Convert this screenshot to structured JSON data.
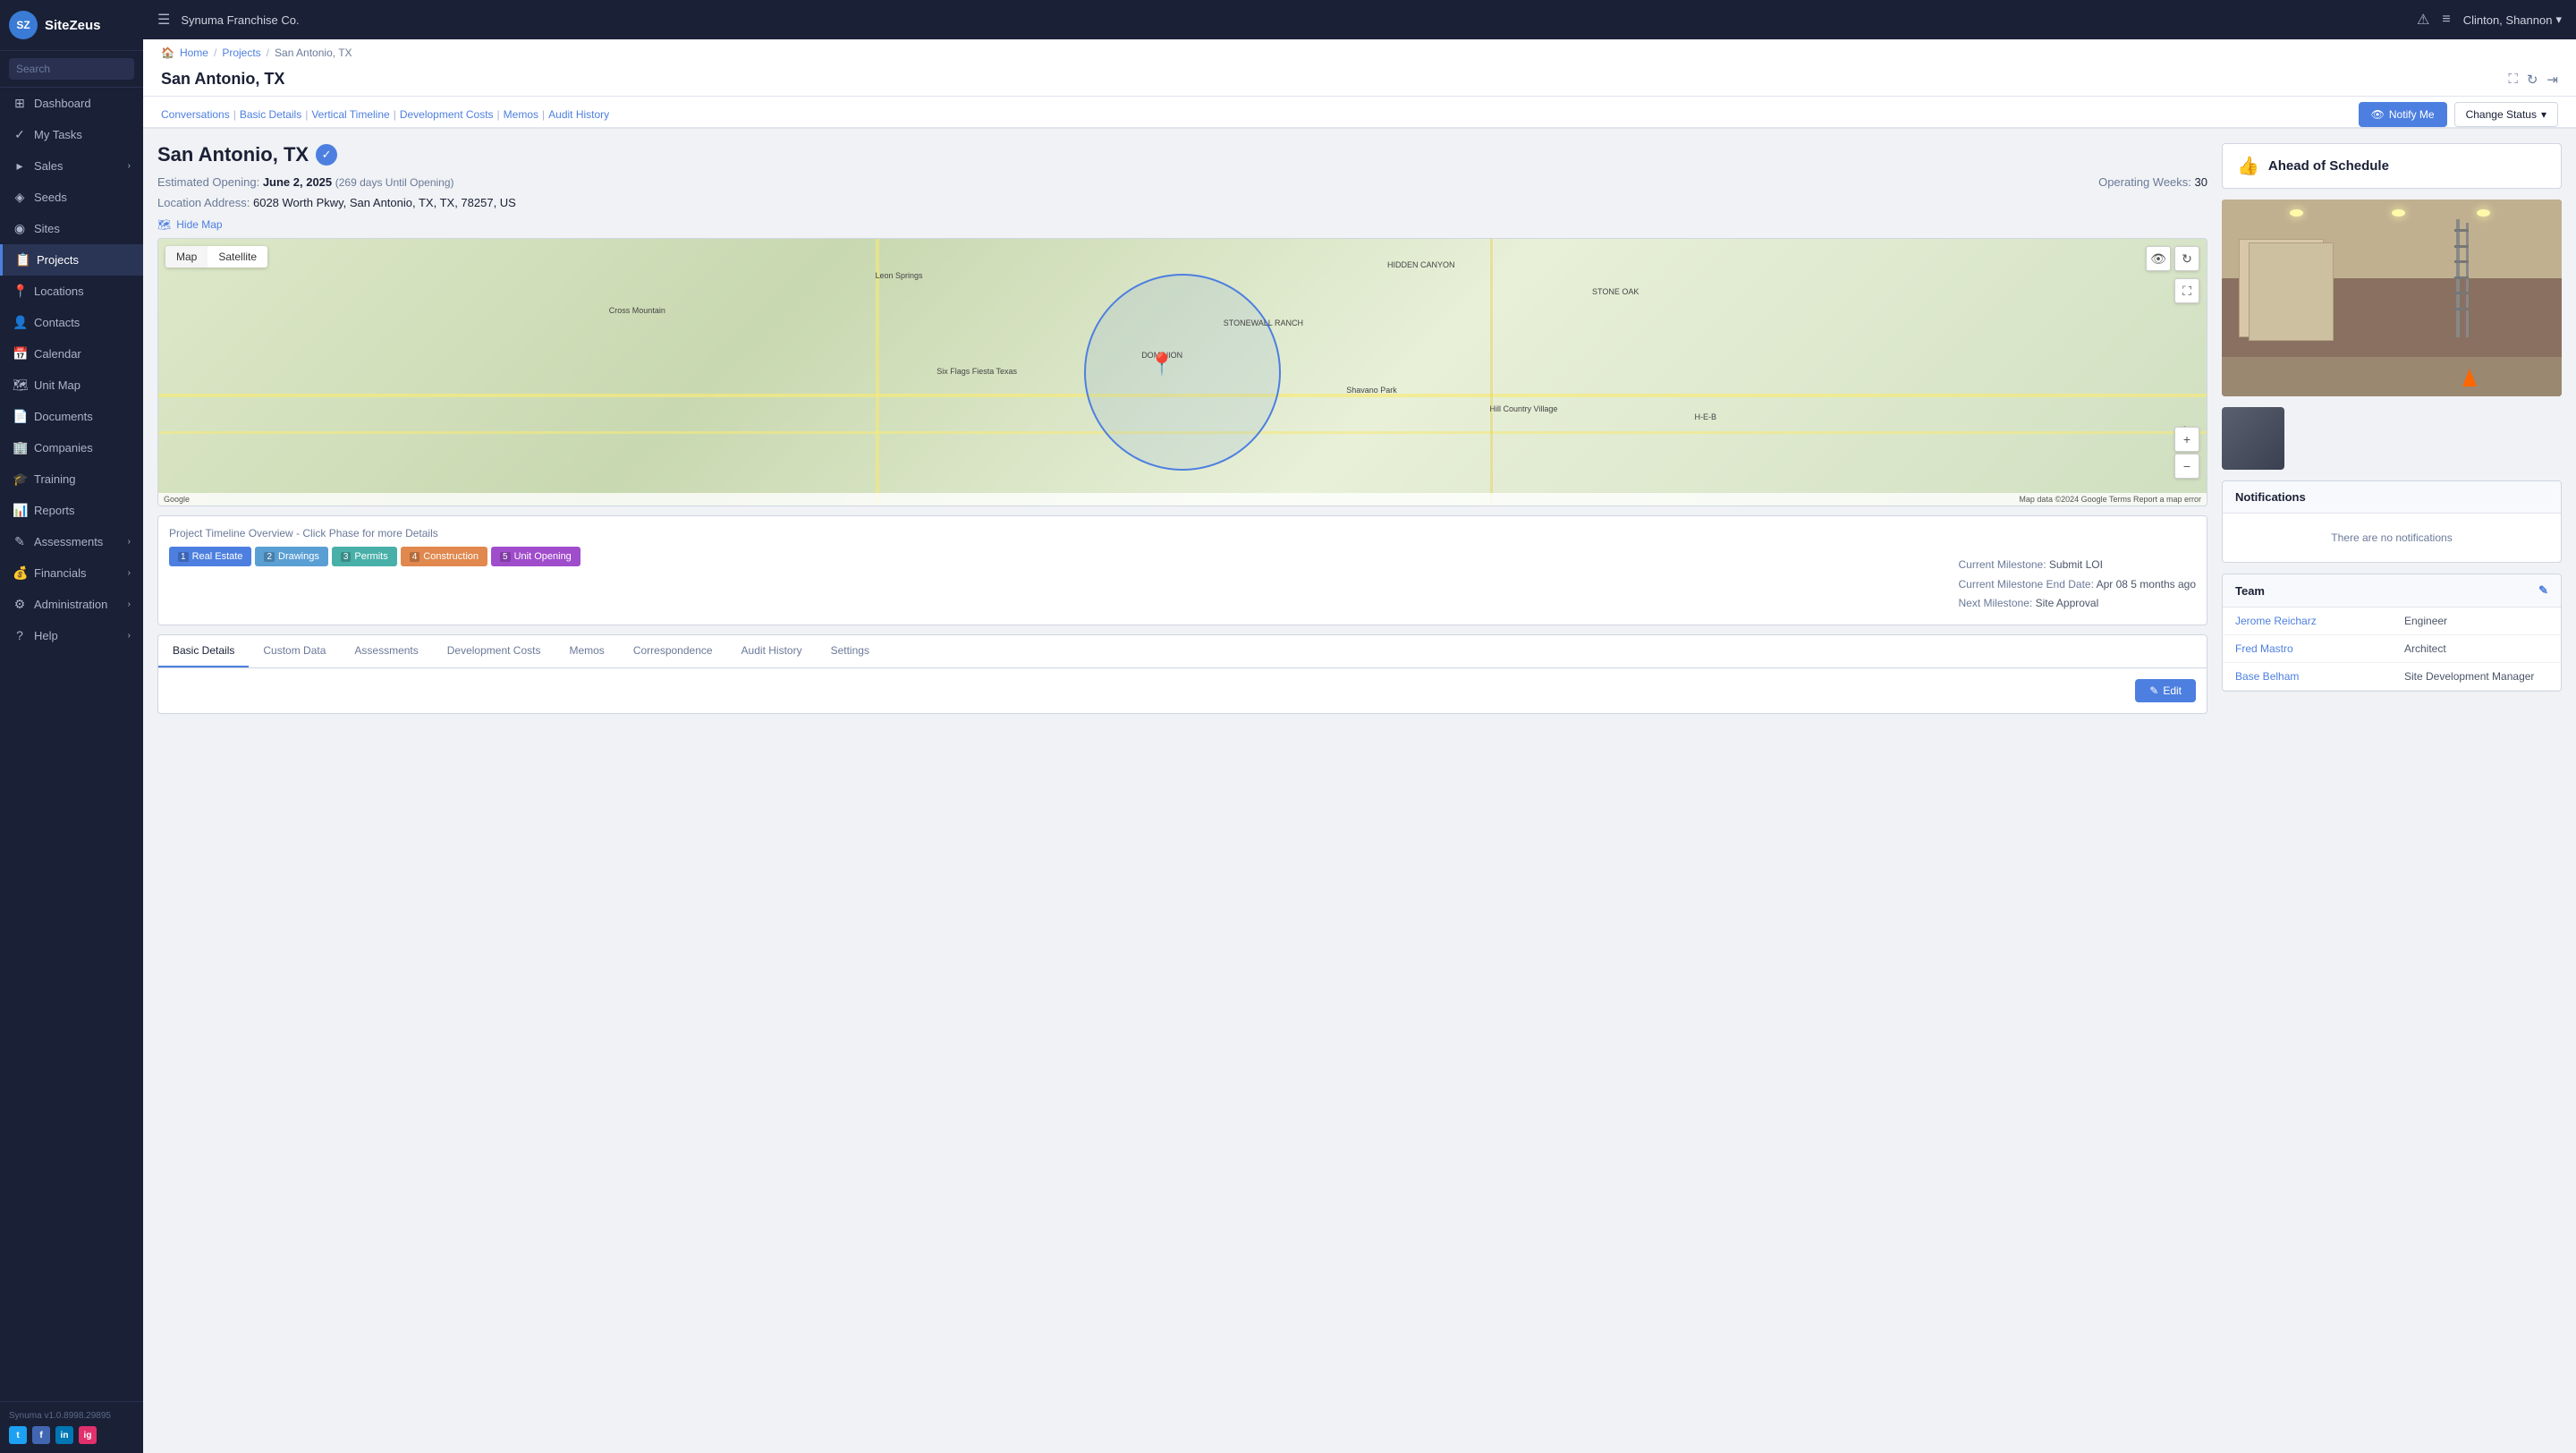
{
  "app": {
    "logo_initials": "SZ",
    "logo_name": "SiteZeus",
    "company": "Synuma Franchise Co.",
    "version": "Synuma v1.0.8998.29895"
  },
  "topbar": {
    "alert_icon": "⚠",
    "messages_icon": "≡",
    "user": "Clinton, Shannon",
    "chevron": "▾"
  },
  "sidebar": {
    "search_placeholder": "Search",
    "items": [
      {
        "id": "dashboard",
        "label": "Dashboard",
        "icon": "⊞",
        "active": false
      },
      {
        "id": "my-tasks",
        "label": "My Tasks",
        "icon": "✓",
        "active": false
      },
      {
        "id": "sales",
        "label": "Sales",
        "icon": "▸",
        "active": false,
        "has_arrow": true
      },
      {
        "id": "seeds",
        "label": "Seeds",
        "icon": "◈",
        "active": false
      },
      {
        "id": "sites",
        "label": "Sites",
        "icon": "◉",
        "active": false
      },
      {
        "id": "projects",
        "label": "Projects",
        "icon": "📋",
        "active": true
      },
      {
        "id": "locations",
        "label": "Locations",
        "icon": "📍",
        "active": false
      },
      {
        "id": "contacts",
        "label": "Contacts",
        "icon": "👤",
        "active": false
      },
      {
        "id": "calendar",
        "label": "Calendar",
        "icon": "📅",
        "active": false
      },
      {
        "id": "unit-map",
        "label": "Unit Map",
        "icon": "🗺",
        "active": false
      },
      {
        "id": "documents",
        "label": "Documents",
        "icon": "📄",
        "active": false
      },
      {
        "id": "companies",
        "label": "Companies",
        "icon": "🏢",
        "active": false
      },
      {
        "id": "training",
        "label": "Training",
        "icon": "🎓",
        "active": false
      },
      {
        "id": "reports",
        "label": "Reports",
        "icon": "📊",
        "active": false
      },
      {
        "id": "assessments",
        "label": "Assessments",
        "icon": "✎",
        "active": false,
        "has_arrow": true
      },
      {
        "id": "financials",
        "label": "Financials",
        "icon": "💰",
        "active": false,
        "has_arrow": true
      },
      {
        "id": "administration",
        "label": "Administration",
        "icon": "⚙",
        "active": false,
        "has_arrow": true
      },
      {
        "id": "help",
        "label": "Help",
        "icon": "?",
        "active": false,
        "has_arrow": true
      }
    ],
    "social": [
      {
        "id": "twitter",
        "label": "t",
        "color": "#1da1f2"
      },
      {
        "id": "facebook",
        "label": "f",
        "color": "#4267b2"
      },
      {
        "id": "linkedin",
        "label": "in",
        "color": "#0077b5"
      },
      {
        "id": "instagram",
        "label": "ig",
        "color": "#e1306c"
      }
    ]
  },
  "breadcrumb": {
    "home": "Home",
    "projects": "Projects",
    "current": "San Antonio, TX"
  },
  "page": {
    "title": "San Antonio, TX",
    "project_name": "San Antonio, TX",
    "verified": true,
    "schedule_status": "Ahead of Schedule",
    "estimated_opening_label": "Estimated Opening:",
    "estimated_opening_date": "June 2, 2025",
    "estimated_opening_days": "(269 days Until Opening)",
    "operating_weeks_label": "Operating Weeks:",
    "operating_weeks": "30",
    "location_address_label": "Location Address:",
    "location_address": "6028 Worth Pkwy, San Antonio, TX, TX, 78257, US",
    "hide_map_label": "Hide Map",
    "map_tab_map": "Map",
    "map_tab_satellite": "Satellite"
  },
  "sub_nav": {
    "links": [
      {
        "id": "conversations",
        "label": "Conversations"
      },
      {
        "id": "basic-details",
        "label": "Basic Details"
      },
      {
        "id": "vertical-timeline",
        "label": "Vertical Timeline"
      },
      {
        "id": "development-costs",
        "label": "Development Costs"
      },
      {
        "id": "memos",
        "label": "Memos"
      },
      {
        "id": "audit-history",
        "label": "Audit History"
      }
    ],
    "notify_label": "Notify Me",
    "change_status_label": "Change Status"
  },
  "timeline": {
    "title": "Project Timeline Overview - Click Phase for more Details",
    "phases": [
      {
        "id": 1,
        "label": "Real Estate",
        "color": "#4d7fe0"
      },
      {
        "id": 2,
        "label": "Drawings",
        "color": "#5a9fd4"
      },
      {
        "id": 3,
        "label": "Permits",
        "color": "#48b0a8"
      },
      {
        "id": 4,
        "label": "Construction",
        "color": "#e0884d"
      },
      {
        "id": 5,
        "label": "Unit Opening",
        "color": "#a04dcc"
      }
    ],
    "current_milestone_label": "Current Milestone:",
    "current_milestone": "Submit LOI",
    "current_milestone_end_label": "Current Milestone End Date:",
    "current_milestone_end": "Apr 08 5 months ago",
    "next_milestone_label": "Next Milestone:",
    "next_milestone": "Site Approval"
  },
  "bottom_tabs": {
    "tabs": [
      {
        "id": "basic-details",
        "label": "Basic Details",
        "active": true
      },
      {
        "id": "custom-data",
        "label": "Custom Data",
        "active": false
      },
      {
        "id": "assessments",
        "label": "Assessments",
        "active": false
      },
      {
        "id": "development-costs",
        "label": "Development Costs",
        "active": false
      },
      {
        "id": "memos",
        "label": "Memos",
        "active": false
      },
      {
        "id": "correspondence",
        "label": "Correspondence",
        "active": false
      },
      {
        "id": "audit-history",
        "label": "Audit History",
        "active": false
      },
      {
        "id": "settings",
        "label": "Settings",
        "active": false
      }
    ],
    "edit_label": "Edit"
  },
  "notifications": {
    "title": "Notifications",
    "empty_message": "There are no notifications"
  },
  "team": {
    "title": "Team",
    "members": [
      {
        "name": "Jerome Reicharz",
        "role": "Engineer"
      },
      {
        "name": "Fred Mastro",
        "role": "Architect"
      },
      {
        "name": "Base Belham",
        "role": "Site Development Manager"
      }
    ],
    "edit_icon": "✎"
  }
}
